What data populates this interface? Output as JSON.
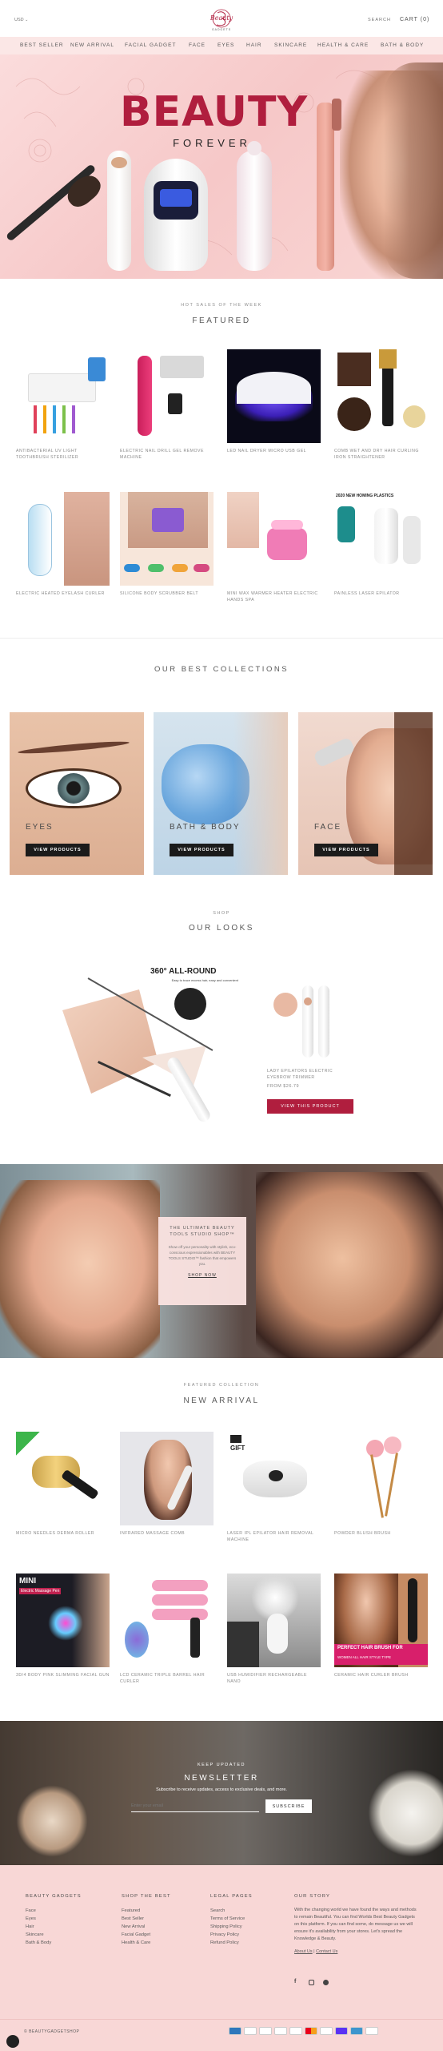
{
  "colors": {
    "accent": "#b01e3e",
    "bg_pink": "#f8d7d6",
    "dark": "#1b1b1b"
  },
  "header": {
    "currency": "USD",
    "logo_text": "Beauty",
    "logo_sub": "GADGETS",
    "search_label": "SEARCH",
    "cart_label": "CART (0)"
  },
  "nav": [
    "BEST SELLER",
    "NEW ARRIVAL",
    "FACIAL GADGET",
    "FACE",
    "EYES",
    "HAIR",
    "SKINCARE",
    "HEALTH & CARE",
    "BATH & BODY"
  ],
  "hero": {
    "title": "BEAUTY",
    "subtitle": "FOREVER"
  },
  "featured": {
    "pre": "HOT SALES OF THE WEEK",
    "title": "FEATURED",
    "products": [
      "ANTIBACTERIAL UV LIGHT TOOTHBRUSH STERILIZER",
      "ELECTRIC NAIL DRILL GEL REMOVE MACHINE",
      "LED NAIL DRYER MICRO USB GEL",
      "COMB WET AND DRY HAIR CURLING IRON STRAIGHTENER",
      "ELECTRIC HEATED EYELASH CURLER",
      "SILICONE BODY SCRUBBER BELT",
      "MINI WAX WARMER HEATER ELECTRIC HANDS SPA",
      "PAINLESS LASER EPILATOR"
    ],
    "image_texts": {
      "epilator_banner": "2020 NEW HOMING PLASTICS"
    }
  },
  "collections": {
    "title": "OUR BEST COLLECTIONS",
    "items": [
      {
        "label": "EYES",
        "button": "VIEW PRODUCTS"
      },
      {
        "label": "BATH & BODY",
        "button": "VIEW PRODUCTS"
      },
      {
        "label": "FACE",
        "button": "VIEW PRODUCTS"
      }
    ]
  },
  "looks": {
    "pre": "SHOP",
    "title": "OUR LOOKS",
    "image_heading": "360° ALL-ROUND",
    "image_sub": "Easy to trace excess hair, easy and convenient",
    "product_title": "LADY EPILATORS ELECTRIC EYEBROW TRIMMER",
    "price": "FROM $26.79",
    "button": "VIEW THIS PRODUCT"
  },
  "promo": {
    "title": "THE ULTIMATE BEAUTY TOOLS STUDIO SHOP™",
    "body": "Show off your personality with stylish, eco-conscious expressionables with BEAUTY TOOLS STUDIO™ fashion that empowers you.",
    "link": "SHOP NOW"
  },
  "new_arrival": {
    "pre": "FEATURED COLLECTION",
    "title": "NEW ARRIVAL",
    "products": [
      "MICRO NEEDLES DERMA ROLLER",
      "INFRARED MASSAGE COMB",
      "LASER IPL EPILATOR HAIR REMOVAL MACHINE",
      "POWDER BLUSH BRUSH",
      "3D/4 BODY PINK SLIMMING FACIAL GUN",
      "LCD CERAMIC TRIPLE BARREL HAIR CURLER",
      "USB HUMIDIFIER RECHARGEABLE NANO",
      "CERAMIC HAIR CURLER BRUSH"
    ],
    "image_texts": {
      "gift": "GIFT",
      "mini": "MINI",
      "mini_sub": "Electric Massage Pen",
      "brush_banner": "PERFECT HAIR BRUSH FOR",
      "brush_banner_sub": "WOMEN ALL HAIR STYLE TYPE"
    }
  },
  "newsletter": {
    "pre": "KEEP UPDATED",
    "title": "NEWSLETTER",
    "text": "Subscribe to receive updates, access to exclusive deals, and more.",
    "placeholder": "Enter your email",
    "button": "SUBSCRIBE"
  },
  "footer": {
    "col1": {
      "title": "BEAUTY GADGETS",
      "links": [
        "Face",
        "Eyes",
        "Hair",
        "Skincare",
        "Bath & Body"
      ]
    },
    "col2": {
      "title": "SHOP THE BEST",
      "links": [
        "Featured",
        "Best Seller",
        "New Arrival",
        "Facial Gadget",
        "Health & Care"
      ]
    },
    "col3": {
      "title": "LEGAL PAGES",
      "links": [
        "Search",
        "Terms of Service",
        "Shipping Policy",
        "Privacy Policy",
        "Refund Policy"
      ]
    },
    "col4": {
      "title": "OUR STORY",
      "text": "With the changing world we have found the ways and methods to remain Beautiful. You can find Worlds Best Beauty Gadgets on this platform. If you can find some, do message us we will ensure it's availability from your stores. Let's spread the Knowledge & Beauty.",
      "links": [
        "About Us",
        "Contact Us"
      ]
    },
    "copyright": "© BEAUTYGADGETSHOP",
    "payments": [
      "AMEX",
      "PAY",
      "D",
      "DISC",
      "G",
      "MC",
      "PP",
      "SHOP",
      "V",
      "VISA"
    ]
  }
}
